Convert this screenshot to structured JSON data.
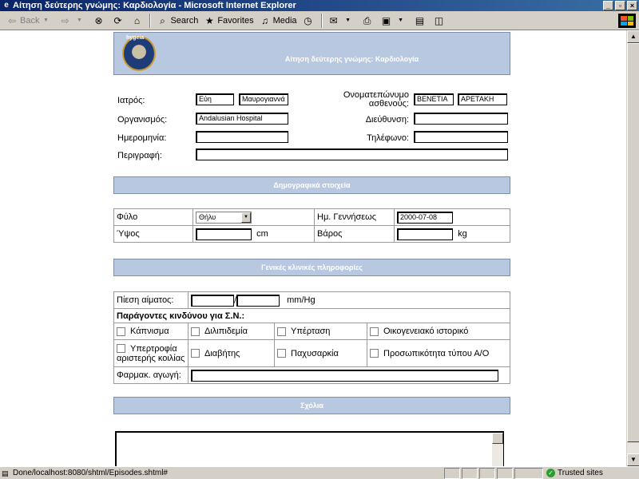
{
  "window": {
    "title": "Αίτηση δεύτερης γνώμης: Καρδιολογία - Microsoft Internet Explorer"
  },
  "toolbar": {
    "back": "Back",
    "search": "Search",
    "favorites": "Favorites",
    "media": "Media"
  },
  "banner": {
    "logo_text": "hygeia",
    "title": "Αίτηση δεύτερης γνώμης: Καρδιολογία"
  },
  "form": {
    "doctor_label": "Ιατρός:",
    "doctor_first": "Εύη",
    "doctor_last": "Μαυρογιαννά",
    "patient_label": "Ονοματεπώνυμο ασθενούς:",
    "patient_first": "ΒΕΝΕΤΙΑ",
    "patient_last": "ΑΡΕΤΑΚΗ",
    "org_label": "Οργανισμός:",
    "org_value": "Andalusian Hospital",
    "address_label": "Διεύθυνση:",
    "address_value": "",
    "date_label": "Ημερομηνία:",
    "date_value": "",
    "phone_label": "Τηλέφωνο:",
    "phone_value": "",
    "desc_label": "Περιγραφή:",
    "desc_value": ""
  },
  "demographics": {
    "section_title": "Δημογραφικά στοιχεία",
    "sex_label": "Φύλο",
    "sex_value": "Θήλυ",
    "dob_label": "Ημ. Γεννήσεως",
    "dob_value": "2000-07-08",
    "height_label": "Ύψος",
    "height_value": "",
    "height_unit": "cm",
    "weight_label": "Βάρος",
    "weight_value": "",
    "weight_unit": "kg"
  },
  "clinical": {
    "section_title": "Γενικές κλινικές πληροφορίες",
    "bp_label": "Πίεση αίματος:",
    "bp_sep": "/",
    "bp_unit": "mm/Hg",
    "risk_label": "Παράγοντες κινδύνου για Σ.Ν.:",
    "risks_row1": [
      "Κάπνισμα",
      "Διλιπιδεμία",
      "Υπέρταση",
      "Οικογενειακό ιστορικό"
    ],
    "risk_lvh_line1": "Υπερτροφία",
    "risk_lvh_line2": "αριστερής κοιλίας",
    "risks_row2": [
      "Διαβήτης",
      "Παχυσαρκία",
      "Προσωπικότητα τύπου Α/Ο"
    ],
    "med_label": "Φαρμακ. αγωγή:",
    "med_value": ""
  },
  "comments": {
    "section_title": "Σχόλια"
  },
  "status": {
    "text": "Done/localhost:8080/shtml/Episodes.shtml#",
    "zone": "Trusted sites"
  }
}
